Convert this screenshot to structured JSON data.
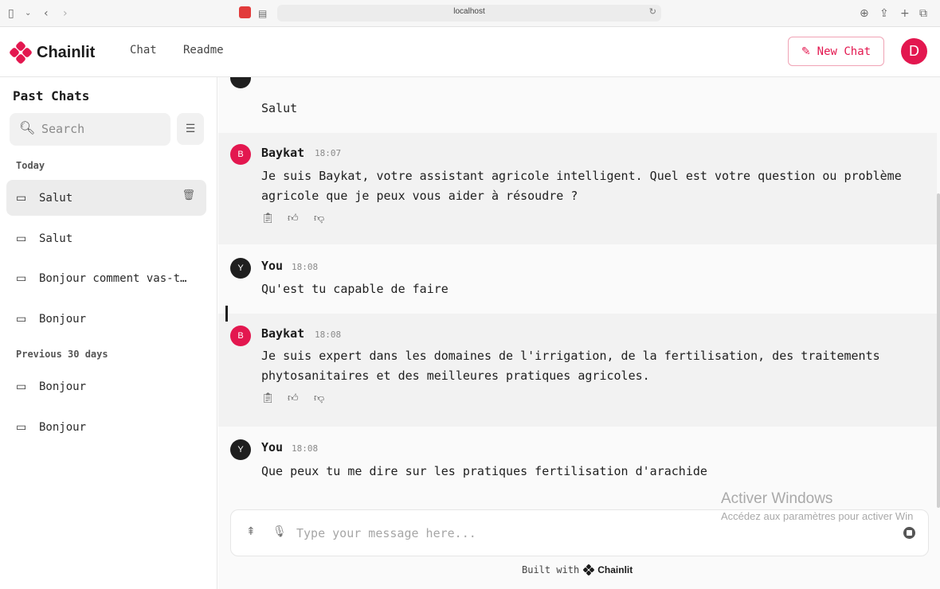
{
  "browser": {
    "url": "localhost",
    "icons": [
      "sidebar-icon",
      "chevron-down-icon",
      "back-icon",
      "forward-icon",
      "tab-favicon",
      "reader-icon",
      "reload-icon",
      "download-icon",
      "share-icon",
      "new-tab-icon",
      "tabs-overview-icon"
    ]
  },
  "header": {
    "logo_text": "Chainlit",
    "nav": [
      "Chat",
      "Readme"
    ],
    "new_chat_label": "New Chat",
    "user_avatar_letter": "D",
    "accent_color": "#e3174f"
  },
  "sidebar": {
    "title": "Past Chats",
    "search_placeholder": "Search",
    "groups": [
      {
        "label": "Today",
        "items": [
          {
            "label": "Salut",
            "active": true
          },
          {
            "label": "Salut",
            "active": false
          },
          {
            "label": "Bonjour comment vas-t…",
            "active": false
          },
          {
            "label": "Bonjour",
            "active": false
          }
        ]
      },
      {
        "label": "Previous 30 days",
        "items": [
          {
            "label": "Bonjour",
            "active": false
          },
          {
            "label": "Bonjour",
            "active": false
          }
        ]
      }
    ]
  },
  "messages": [
    {
      "author": "",
      "time": "",
      "avatar": "",
      "text": "Salut",
      "role": "user"
    },
    {
      "author": "Baykat",
      "time": "18:07",
      "avatar": "B",
      "text": "Je suis Baykat, votre assistant agricole intelligent. Quel est votre question ou problème agricole que je peux vous aider à résoudre ?",
      "role": "bot"
    },
    {
      "author": "You",
      "time": "18:08",
      "avatar": "Y",
      "text": "Qu'est tu capable de faire",
      "role": "user"
    },
    {
      "author": "Baykat",
      "time": "18:08",
      "avatar": "B",
      "text": "Je suis expert dans les domaines de l'irrigation, de la fertilisation, des traitements phytosanitaires et des meilleures pratiques agricoles.",
      "role": "bot"
    },
    {
      "author": "You",
      "time": "18:08",
      "avatar": "Y",
      "text": "Que peux tu me dire sur les pratiques fertilisation d'arachide",
      "role": "user"
    }
  ],
  "composer": {
    "placeholder": "Type your message here..."
  },
  "footer": {
    "built_with": "Built with",
    "brand": "Chainlit"
  },
  "watermark": {
    "line1": "Activer Windows",
    "line2": "Accédez aux paramètres pour activer Win"
  }
}
